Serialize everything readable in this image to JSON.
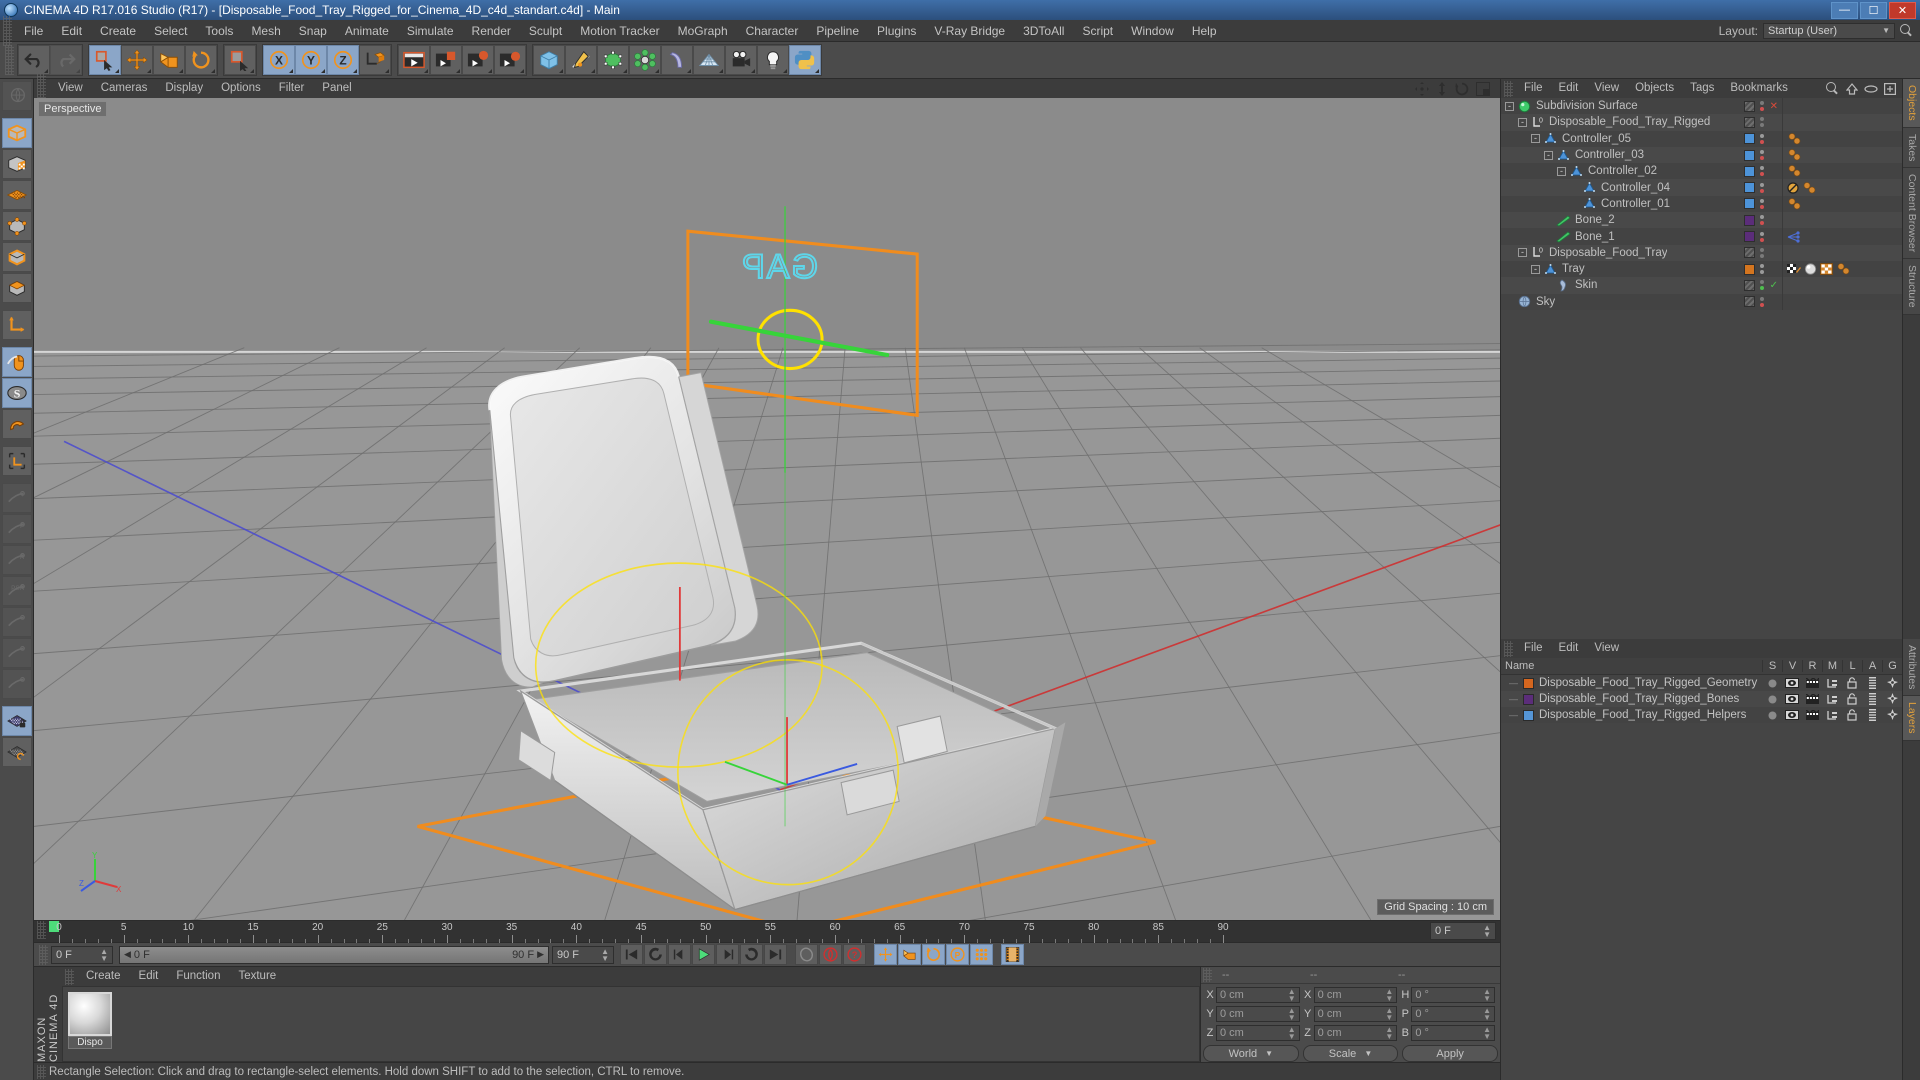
{
  "titlebar": {
    "title": "CINEMA 4D R17.016 Studio (R17) - [Disposable_Food_Tray_Rigged_for_Cinema_4D_c4d_standart.c4d] - Main",
    "minimize": "—",
    "maximize": "☐",
    "close": "✕"
  },
  "menubar": {
    "items": [
      "File",
      "Edit",
      "Create",
      "Select",
      "Tools",
      "Mesh",
      "Snap",
      "Animate",
      "Simulate",
      "Render",
      "Sculpt",
      "Motion Tracker",
      "MoGraph",
      "Character",
      "Pipeline",
      "Plugins",
      "V-Ray Bridge",
      "3DToAll",
      "Script",
      "Window",
      "Help"
    ],
    "layout_label": "Layout:",
    "layout_value": "Startup (User)"
  },
  "toolbar": {
    "groups": [
      {
        "name": "history",
        "buttons": [
          {
            "name": "undo-button",
            "icon": "undo",
            "state": "normal"
          },
          {
            "name": "redo-button",
            "icon": "redo",
            "state": "disabled"
          }
        ]
      },
      {
        "name": "selection",
        "buttons": [
          {
            "name": "live-selection-button",
            "icon": "live-select",
            "state": "selected"
          },
          {
            "name": "move-button",
            "icon": "move",
            "state": "normal"
          },
          {
            "name": "scale-button",
            "icon": "scale",
            "state": "normal"
          },
          {
            "name": "rotate-button",
            "icon": "rotate",
            "state": "normal"
          }
        ]
      },
      {
        "name": "select-tool",
        "buttons": [
          {
            "name": "rectangle-selection-button",
            "icon": "rect-select",
            "state": "normal"
          }
        ]
      },
      {
        "name": "axis-locks",
        "buttons": [
          {
            "name": "lock-x-button",
            "icon": "axis-x",
            "state": "selected"
          },
          {
            "name": "lock-y-button",
            "icon": "axis-y",
            "state": "selected"
          },
          {
            "name": "lock-z-button",
            "icon": "axis-z",
            "state": "selected"
          },
          {
            "name": "world-object-coord-button",
            "icon": "world-coord",
            "state": "normal"
          }
        ]
      },
      {
        "name": "render",
        "buttons": [
          {
            "name": "render-view-button",
            "icon": "render-view",
            "state": "normal"
          },
          {
            "name": "render-region-button",
            "icon": "render-region",
            "state": "normal"
          },
          {
            "name": "render-to-picture-viewer-button",
            "icon": "render-pv",
            "state": "normal"
          },
          {
            "name": "render-settings-button",
            "icon": "render-settings",
            "state": "normal"
          }
        ]
      },
      {
        "name": "creation",
        "buttons": [
          {
            "name": "add-cube-button",
            "icon": "cube",
            "state": "normal"
          },
          {
            "name": "add-spline-button",
            "icon": "spline-pen",
            "state": "normal"
          },
          {
            "name": "add-nurbs-button",
            "icon": "nurbs",
            "state": "normal"
          },
          {
            "name": "add-modeling-object-button",
            "icon": "array",
            "state": "normal"
          },
          {
            "name": "add-deformer-button",
            "icon": "bend",
            "state": "normal"
          },
          {
            "name": "add-environment-button",
            "icon": "floor",
            "state": "normal"
          },
          {
            "name": "add-camera-button",
            "icon": "camera",
            "state": "normal"
          },
          {
            "name": "add-light-button",
            "icon": "light",
            "state": "normal"
          },
          {
            "name": "python-button",
            "icon": "python",
            "state": "selected"
          }
        ]
      }
    ]
  },
  "leftbar": {
    "buttons": [
      {
        "name": "make-editable-button",
        "icon": "globe-editable",
        "state": "disabled"
      },
      {
        "name": "model-mode-button",
        "icon": "model",
        "state": "selected"
      },
      {
        "name": "texture-mode-button",
        "icon": "texture",
        "state": "normal"
      },
      {
        "name": "workplane-mode-button",
        "icon": "workplane",
        "state": "normal"
      },
      {
        "name": "point-mode-button",
        "icon": "points",
        "state": "normal"
      },
      {
        "name": "edge-mode-button",
        "icon": "edges",
        "state": "normal"
      },
      {
        "name": "polygon-mode-button",
        "icon": "polygons",
        "state": "normal"
      },
      {
        "name": "object-axis-button",
        "icon": "axis",
        "state": "normal"
      },
      {
        "name": "viewport-solo-button",
        "icon": "mouse",
        "state": "selected"
      },
      {
        "name": "soft-selection-button",
        "icon": "s-sphere",
        "state": "selected"
      },
      {
        "name": "enable-snap-button",
        "icon": "magnet",
        "state": "normal"
      },
      {
        "name": "workplane-lock-button",
        "icon": "corner-axis",
        "state": "normal"
      },
      {
        "name": "animate-position-button",
        "icon": "key-plus",
        "state": "disabled"
      },
      {
        "name": "animate-p-button",
        "icon": "key-p",
        "state": "disabled"
      },
      {
        "name": "animate-r-button",
        "icon": "key-r",
        "state": "disabled"
      },
      {
        "name": "animate-psr-button",
        "icon": "key-psr",
        "state": "disabled"
      },
      {
        "name": "animate-point-level-button",
        "icon": "key-point",
        "state": "disabled"
      },
      {
        "name": "animate-param-button",
        "icon": "key-param",
        "state": "disabled"
      },
      {
        "name": "animate-tool-button",
        "icon": "key-tool",
        "state": "disabled"
      },
      {
        "name": "grid-lock-button",
        "icon": "grid-lock",
        "state": "selected"
      },
      {
        "name": "grid-cycle-button",
        "icon": "grid-cycle",
        "state": "normal"
      }
    ]
  },
  "viewport": {
    "menu": [
      "View",
      "Cameras",
      "Display",
      "Options",
      "Filter",
      "Panel"
    ],
    "view_label": "Perspective",
    "grid_spacing": "Grid Spacing : 10 cm",
    "scene_text": "GAP",
    "axis_labels": {
      "x": "X",
      "y": "Y",
      "z": "Z"
    },
    "colors": {
      "controller_frame": "#f08c1e",
      "helper_ring": "#ffe100",
      "axis_green": "#37d43a",
      "axis_red": "#e03a3a",
      "axis_blue": "#3a5ae0",
      "text_cyan": "#5ed6ea",
      "object_white": "#e7e7e7"
    }
  },
  "timeline": {
    "ticks": [
      0,
      5,
      10,
      15,
      20,
      25,
      30,
      35,
      40,
      45,
      50,
      55,
      60,
      65,
      70,
      75,
      80,
      85,
      90
    ],
    "start_frame": "0 F",
    "end_frame": "90 F",
    "current_frame_box": "0 F",
    "scrub_left_label": "0 F",
    "scrub_right_label": "90 F",
    "preview_end": "90 F"
  },
  "player": {
    "buttons": [
      {
        "name": "goto-start-button",
        "icon": "skip-start"
      },
      {
        "name": "previous-key-button",
        "icon": "prev-key"
      },
      {
        "name": "previous-frame-button",
        "icon": "prev-frame"
      },
      {
        "name": "play-button",
        "icon": "play"
      },
      {
        "name": "next-frame-button",
        "icon": "next-frame"
      },
      {
        "name": "next-key-button",
        "icon": "next-key"
      },
      {
        "name": "goto-end-button",
        "icon": "skip-end"
      },
      {
        "name": "record-active-objects-button",
        "icon": "record-gray"
      },
      {
        "name": "autokeying-button",
        "icon": "autokey"
      },
      {
        "name": "keyframe-selection-button",
        "icon": "key-question"
      },
      {
        "name": "position-key-button",
        "icon": "key-position"
      },
      {
        "name": "scale-key-button",
        "icon": "key-scale"
      },
      {
        "name": "rotation-key-button",
        "icon": "key-rotation"
      },
      {
        "name": "param-key-button",
        "icon": "key-param-p"
      },
      {
        "name": "pla-key-button",
        "icon": "key-pla"
      },
      {
        "name": "timeline-button",
        "icon": "filmstrip"
      }
    ]
  },
  "materials": {
    "menu": [
      "Create",
      "Edit",
      "Function",
      "Texture"
    ],
    "items": [
      {
        "name": "Dispo"
      }
    ],
    "brand": "MAXON CINEMA 4D"
  },
  "coordinates": {
    "headers": [
      "--",
      "--",
      "--"
    ],
    "rows": [
      {
        "axis1": "X",
        "value1": "0 cm",
        "axis2": "X",
        "value2": "0 cm",
        "axis3": "H",
        "value3": "0 °"
      },
      {
        "axis1": "Y",
        "value1": "0 cm",
        "axis2": "Y",
        "value2": "0 cm",
        "axis3": "P",
        "value3": "0 °"
      },
      {
        "axis1": "Z",
        "value1": "0 cm",
        "axis2": "Z",
        "value2": "0 cm",
        "axis3": "B",
        "value3": "0 °"
      }
    ],
    "system": "World",
    "mode": "Scale",
    "apply": "Apply"
  },
  "statusbar": {
    "text": "Rectangle Selection: Click and drag to rectangle-select elements. Hold down SHIFT to add to the selection, CTRL to remove."
  },
  "objectmanager": {
    "menu": [
      "File",
      "Edit",
      "View",
      "Objects",
      "Tags",
      "Bookmarks"
    ],
    "rows": [
      {
        "label": "Subdivision Surface",
        "indent": 0,
        "icon": "subdivision-surface",
        "expander": "-",
        "chip": "hatch",
        "dot_top": "#7a7a7a",
        "dot_bot": "#d05050",
        "tags": [],
        "mark": "x"
      },
      {
        "label": "Disposable_Food_Tray_Rigged",
        "indent": 1,
        "icon": "null-layer",
        "expander": "-",
        "chip": "hatch",
        "dot_top": "#7a7a7a",
        "dot_bot": "#7a7a7a",
        "tags": []
      },
      {
        "label": "Controller_05",
        "indent": 2,
        "icon": "null-cone",
        "expander": "-",
        "chip": "#4d93d8",
        "dot_top": "#9a9a9a",
        "dot_bot": "#d05050",
        "tags": [
          "dots"
        ]
      },
      {
        "label": "Controller_03",
        "indent": 3,
        "icon": "null-cone",
        "expander": "-",
        "chip": "#4d93d8",
        "dot_top": "#9a9a9a",
        "dot_bot": "#d05050",
        "tags": [
          "dots"
        ]
      },
      {
        "label": "Controller_02",
        "indent": 4,
        "icon": "null-cone",
        "expander": "-",
        "chip": "#4d93d8",
        "dot_top": "#9a9a9a",
        "dot_bot": "#d05050",
        "tags": [
          "dots"
        ]
      },
      {
        "label": "Controller_04",
        "indent": 5,
        "icon": "null-cone",
        "expander": "",
        "chip": "#4d93d8",
        "dot_top": "#9a9a9a",
        "dot_bot": "#d05050",
        "tags": [
          "noentry",
          "dots"
        ]
      },
      {
        "label": "Controller_01",
        "indent": 5,
        "icon": "null-cone",
        "expander": "",
        "chip": "#4d93d8",
        "dot_top": "#9a9a9a",
        "dot_bot": "#d05050",
        "tags": [
          "dots"
        ]
      },
      {
        "label": "Bone_2",
        "indent": 3,
        "icon": "bone",
        "expander": "",
        "chip": "#5b2d7a",
        "dot_top": "#9a9a9a",
        "dot_bot": "#d05050",
        "tags": []
      },
      {
        "label": "Bone_1",
        "indent": 3,
        "icon": "bone",
        "expander": "",
        "chip": "#5b2d7a",
        "dot_top": "#9a9a9a",
        "dot_bot": "#d05050",
        "tags": [
          "weight"
        ]
      },
      {
        "label": "Disposable_Food_Tray",
        "indent": 1,
        "icon": "null-layer",
        "expander": "-",
        "chip": "hatch",
        "dot_top": "#7a7a7a",
        "dot_bot": "#7a7a7a",
        "tags": []
      },
      {
        "label": "Tray",
        "indent": 2,
        "icon": "null-cone",
        "expander": "-",
        "chip": "#d4751f",
        "dot_top": "#9a9a9a",
        "dot_bot": "#9a9a9a",
        "tags": [
          "uvw",
          "material",
          "checker",
          "dots"
        ]
      },
      {
        "label": "Skin",
        "indent": 3,
        "icon": "skin",
        "expander": "",
        "chip": "hatch",
        "dot_top": "#7a7a7a",
        "dot_bot": "#4fbf4f",
        "tags": [],
        "mark": "check"
      },
      {
        "label": "Sky",
        "indent": 0,
        "icon": "sky",
        "expander": "",
        "chip": "hatch",
        "dot_top": "#7a7a7a",
        "dot_bot": "#d05050",
        "tags": []
      }
    ],
    "sidetabs": [
      "Objects",
      "Takes",
      "Content Browser",
      "Structure"
    ]
  },
  "layermanager": {
    "menu": [
      "File",
      "Edit",
      "View"
    ],
    "headers": [
      "Name",
      "S",
      "V",
      "R",
      "M",
      "L",
      "A",
      "G"
    ],
    "rows": [
      {
        "name": "Disposable_Food_Tray_Rigged_Geometry",
        "color": "#d4661f"
      },
      {
        "name": "Disposable_Food_Tray_Rigged_Bones",
        "color": "#5b2d7a"
      },
      {
        "name": "Disposable_Food_Tray_Rigged_Helpers",
        "color": "#5595d6"
      }
    ],
    "sidetabs": [
      "Attributes",
      "Layers"
    ]
  }
}
